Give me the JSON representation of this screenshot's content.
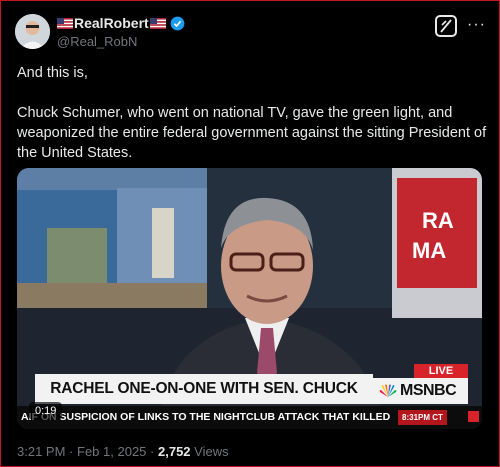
{
  "author": {
    "display_name": "RealRobert",
    "handle": "@Real_RobN",
    "flag_icon": "us-flag-icon",
    "verified_icon": "verified-badge-icon",
    "verified_color": "#1d9bf0"
  },
  "actions": {
    "grok_icon": "grok-icon",
    "more_label": "···"
  },
  "post": {
    "line1": "And this is,",
    "line2": "Chuck Schumer, who went on national TV, gave the green light, and weaponized the entire federal government against the sitting President of the United States."
  },
  "media": {
    "lower_third": "RACHEL ONE-ON-ONE WITH SEN. CHUCK SCHUMER",
    "live_label": "LIVE",
    "network_label": "MSNBC",
    "ticker_text": "AIF   ON SUSPICION OF LINKS TO THE NIGHTCLUB ATTACK THAT KILLED",
    "ticker_time": "8:31PM CT",
    "duration": "0:19",
    "accent_color": "#d8232a"
  },
  "meta": {
    "time": "3:21 PM",
    "separator": "·",
    "date": "Feb 1, 2025",
    "views_count": "2,752",
    "views_label": "Views"
  }
}
